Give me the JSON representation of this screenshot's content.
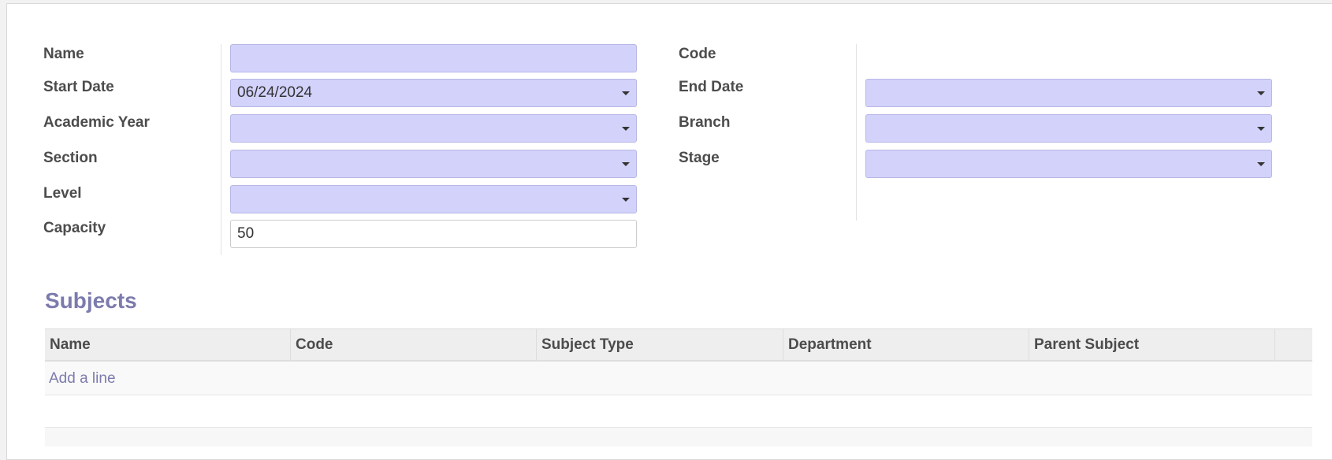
{
  "form": {
    "left": {
      "name_label": "Name",
      "name_value": "",
      "start_date_label": "Start Date",
      "start_date_value": "06/24/2024",
      "academic_year_label": "Academic Year",
      "academic_year_value": "",
      "section_label": "Section",
      "section_value": "",
      "level_label": "Level",
      "level_value": "",
      "capacity_label": "Capacity",
      "capacity_value": "50"
    },
    "right": {
      "code_label": "Code",
      "code_value": "",
      "end_date_label": "End Date",
      "end_date_value": "",
      "branch_label": "Branch",
      "branch_value": "",
      "stage_label": "Stage",
      "stage_value": ""
    }
  },
  "subjects": {
    "title": "Subjects",
    "columns": [
      "Name",
      "Code",
      "Subject Type",
      "Department",
      "Parent Subject"
    ],
    "add_line": "Add a line",
    "rows": []
  },
  "colors": {
    "required_field_bg": "#d2d2fb",
    "accent": "#7c7bad"
  },
  "icons": {
    "dropdown": "caret-down-icon"
  }
}
